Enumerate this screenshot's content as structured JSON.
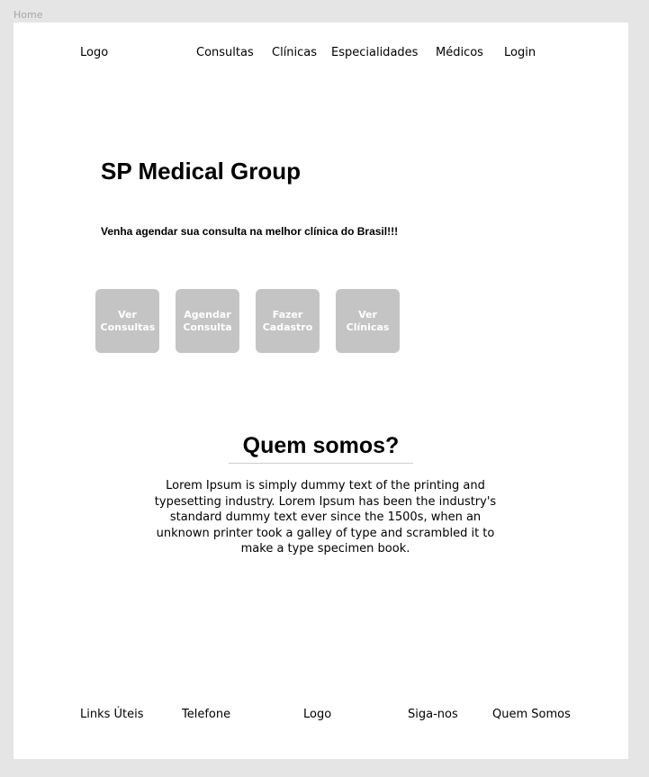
{
  "frame": {
    "label": "Home"
  },
  "header": {
    "logo": "Logo",
    "nav": {
      "consultas": "Consultas",
      "clinicas": "Clínicas",
      "especialidades": "Especialidades",
      "medicos": "Médicos",
      "login": "Login"
    }
  },
  "hero": {
    "title": "SP Medical Group",
    "subtitle": "Venha agendar sua consulta na melhor clínica do Brasil!!!"
  },
  "actions": {
    "ver_consultas": "Ver Consultas",
    "agendar_consulta": "Agendar Consulta",
    "fazer_cadastro": "Fazer Cadastro",
    "ver_clinicas": "Ver Clínicas"
  },
  "about": {
    "title": "Quem somos?",
    "text": "Lorem Ipsum is simply dummy text of the printing and typesetting industry. Lorem Ipsum has been the industry's standard dummy text ever since the 1500s, when an unknown printer took a galley of type and scrambled it to make a type specimen book."
  },
  "footer": {
    "links_uteis": "Links Úteis",
    "telefone": "Telefone",
    "logo": "Logo",
    "siga_nos": "Siga-nos",
    "quem_somos": "Quem Somos"
  },
  "colors": {
    "canvas": "#e5e5e5",
    "page": "#ffffff",
    "button": "#c4c4c4",
    "button_text": "#ffffff",
    "frame_label": "#a6a6a6"
  }
}
